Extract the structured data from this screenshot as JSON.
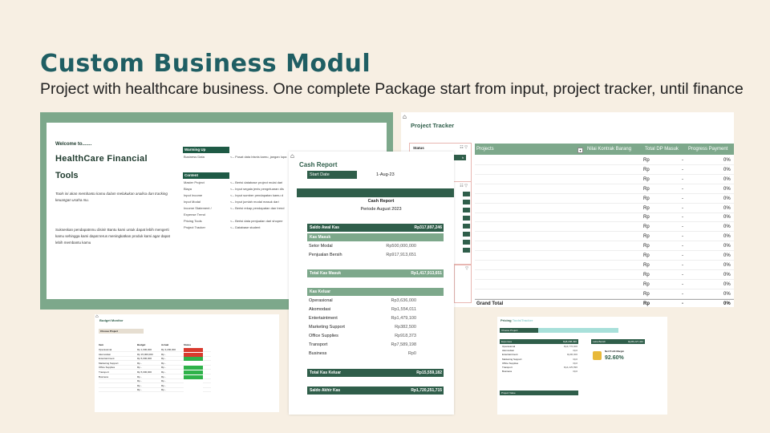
{
  "header": {
    "title": "Custom Business Modul",
    "subtitle": "Project with healthcare business. One complete Package start from input, project tracker, until finance"
  },
  "welcome": {
    "label": "Welcome to.......",
    "title_line1": "HealthCare Financial",
    "title_line2": "Tools",
    "para1": "Tools ini akan membantu kamu dalam melakukan analisa dan tracking keuangan usaha mu.",
    "para2": "Sukseskan pendapatnmu disini! Bantu kami untuk dapat lebih mengerti kamu sehingga kami dapat terus meningkatkan produk kami agar dapat lebih membantu kamu",
    "warming_up": "Warming Up",
    "warming_items": [
      {
        "name": "Business Data",
        "desc": "<-- Pusat data bisnis kamu, jangan lupa"
      }
    ],
    "content": "Content",
    "content_items": [
      {
        "name": "Master Project",
        "desc": "<-- Berisi database project mulai dari"
      },
      {
        "name": "Biaya",
        "desc": "<-- Input segala jenis pengeluaran dis"
      },
      {
        "name": "Input Income",
        "desc": "<-- Input sumber pendapatan kamu d"
      },
      {
        "name": "Input Modal",
        "desc": "<-- Input jumlah modal masuk dari"
      },
      {
        "name": "Income Statement /",
        "desc": "<-- Berisi rekap pendapatan dan trend"
      },
      {
        "name": "Expense Trend",
        "desc": ""
      },
      {
        "name": "Pricing Tools",
        "desc": "<-- Berisi data penjualan dari shopee"
      },
      {
        "name": "Project Tracker",
        "desc": "<-- Database student"
      }
    ]
  },
  "tracker": {
    "title": "Project Tracker",
    "filter_label": "Status",
    "filter_icons": "☷ ▽",
    "selected_chip": "h",
    "columns": [
      "Projects",
      "Nilai Kontrak Barang",
      "Total DP Masuk",
      "Progress Payment"
    ],
    "rows": [
      {
        "rp": "Rp",
        "dash": "-",
        "pct": "0%"
      },
      {
        "rp": "Rp",
        "dash": "-",
        "pct": "0%"
      },
      {
        "rp": "Rp",
        "dash": "-",
        "pct": "0%"
      },
      {
        "rp": "Rp",
        "dash": "-",
        "pct": "0%"
      },
      {
        "rp": "Rp",
        "dash": "-",
        "pct": "0%"
      },
      {
        "rp": "Rp",
        "dash": "-",
        "pct": "0%"
      },
      {
        "rp": "Rp",
        "dash": "-",
        "pct": "0%"
      },
      {
        "rp": "Rp",
        "dash": "-",
        "pct": "0%"
      },
      {
        "rp": "Rp",
        "dash": "-",
        "pct": "0%"
      },
      {
        "rp": "Rp",
        "dash": "-",
        "pct": "0%"
      },
      {
        "rp": "Rp",
        "dash": "-",
        "pct": "0%"
      },
      {
        "rp": "Rp",
        "dash": "-",
        "pct": "0%"
      },
      {
        "rp": "Rp",
        "dash": "-",
        "pct": "0%"
      },
      {
        "rp": "Rp",
        "dash": "-",
        "pct": "0%"
      },
      {
        "rp": "Rp",
        "dash": "-",
        "pct": "0%"
      }
    ],
    "grand_total": {
      "label": "Grand Total",
      "rp": "Rp",
      "dash": "-",
      "pct": "0%"
    }
  },
  "cash": {
    "title": "Cash Report",
    "start_label": "Start Date",
    "start_value": "1-Aug-23",
    "report_title": "Cash Report",
    "period": "Periode August 2023",
    "saldo_awal": {
      "label": "Saldo Awal Kas",
      "value": "Rp317,897,246"
    },
    "kas_masuk": "Kas Masuk",
    "masuk_rows": [
      {
        "label": "Setor Modal",
        "value": "Rp500,000,000"
      },
      {
        "label": "Penjualan Bersih",
        "value": "Rp917,913,651"
      }
    ],
    "total_masuk": {
      "label": "Total Kas Masuk",
      "value": "Rp1,417,913,651"
    },
    "kas_keluar": "Kas Keluar",
    "keluar_rows": [
      {
        "label": "Operasional",
        "value": "Rp3,636,000"
      },
      {
        "label": "Akomodasi",
        "value": "Rp1,554,011"
      },
      {
        "label": "Entertaintment",
        "value": "Rp1,479,100"
      },
      {
        "label": "Marketing Support",
        "value": "Rp382,500"
      },
      {
        "label": "Office Supplies",
        "value": "Rp918,373"
      },
      {
        "label": "Transport",
        "value": "Rp7,589,198"
      },
      {
        "label": "Business",
        "value": "Rp0"
      }
    ],
    "total_keluar": {
      "label": "Total Kas Keluar",
      "value": "Rp15,559,182"
    },
    "saldo_akhir": {
      "label": "Saldo Akhir Kas",
      "value": "Rp1,720,251,715"
    }
  },
  "budget": {
    "title": "Budget Monitor",
    "select": "Choose Project",
    "columns": [
      "Item",
      "Budget",
      "Actual",
      "Status"
    ],
    "rows": [
      {
        "item": "Operasional",
        "budget": "Rp 1,000,000",
        "actual": "Rp 3,200,000",
        "status": "#d93a2e"
      },
      {
        "item": "Akomodasi",
        "budget": "Rp 15,000,000",
        "actual": "Rp -",
        "status": "#d93a2e"
      },
      {
        "item": "Entertaintment",
        "budget": "Rp 5,000,000",
        "actual": "Rp -",
        "status": "#2fb24a"
      },
      {
        "item": "Marketing Support",
        "budget": "Rp -",
        "actual": "Rp -",
        "status": "#ffffff"
      },
      {
        "item": "Office Supplies",
        "budget": "Rp -",
        "actual": "Rp -",
        "status": "#2fb24a"
      },
      {
        "item": "Transport",
        "budget": "Rp 5,000,000",
        "actual": "Rp -",
        "status": "#2fb24a"
      },
      {
        "item": "Business",
        "budget": "Rp -",
        "actual": "Rp -",
        "status": "#2fb24a"
      },
      {
        "item": "",
        "budget": "Rp -",
        "actual": "Rp -",
        "status": "#ffffff"
      },
      {
        "item": "",
        "budget": "Rp -",
        "actual": "Rp -",
        "status": "#ffffff"
      },
      {
        "item": "",
        "budget": "Rp -",
        "actual": "Rp -",
        "status": "#ffffff"
      }
    ]
  },
  "pricing": {
    "title_main": "Pricing",
    "title_light": "Tools/Tracker",
    "choose": "Choose Project",
    "expenses": {
      "label": "Expenses",
      "value": "Rp8,298,496"
    },
    "rows": [
      {
        "label": "Operasional",
        "value": "Rp3,776,600"
      },
      {
        "label": "Akomodasi",
        "value": "Rp0"
      },
      {
        "label": "Entertaintment",
        "value": "Rp96,000"
      },
      {
        "label": "Marketing Support",
        "value": "Rp0"
      },
      {
        "label": "Office Supplies",
        "value": "Rp0"
      },
      {
        "label": "Transport",
        "value": "Rp4,225,896"
      },
      {
        "label": "Business",
        "value": "Rp0"
      }
    ],
    "project_value": "Project Value",
    "laba": {
      "label": "Laba Bersih",
      "value": "Rp95,227,442"
    },
    "npm_label": "Net Profit Margin",
    "npm_value": "92.60%"
  }
}
